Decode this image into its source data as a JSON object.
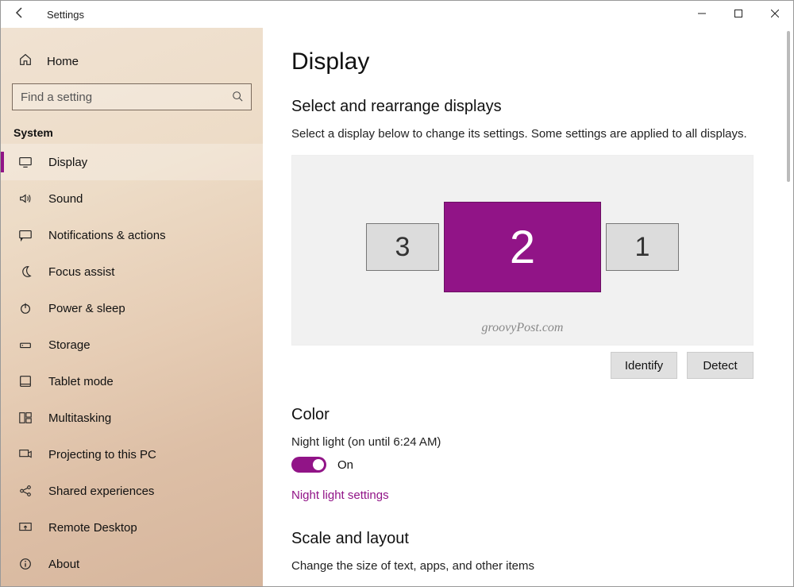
{
  "accent_color": "#911487",
  "titlebar": {
    "title": "Settings"
  },
  "sidebar": {
    "home_label": "Home",
    "search_placeholder": "Find a setting",
    "section_title": "System",
    "items": [
      {
        "id": "display",
        "label": "Display",
        "icon": "monitor",
        "active": true
      },
      {
        "id": "sound",
        "label": "Sound",
        "icon": "sound",
        "active": false
      },
      {
        "id": "notifications",
        "label": "Notifications & actions",
        "icon": "chat",
        "active": false
      },
      {
        "id": "focus",
        "label": "Focus assist",
        "icon": "moon",
        "active": false
      },
      {
        "id": "power",
        "label": "Power & sleep",
        "icon": "power",
        "active": false
      },
      {
        "id": "storage",
        "label": "Storage",
        "icon": "storage",
        "active": false
      },
      {
        "id": "tablet",
        "label": "Tablet mode",
        "icon": "tablet",
        "active": false
      },
      {
        "id": "multitask",
        "label": "Multitasking",
        "icon": "multitask",
        "active": false
      },
      {
        "id": "projecting",
        "label": "Projecting to this PC",
        "icon": "project",
        "active": false
      },
      {
        "id": "shared",
        "label": "Shared experiences",
        "icon": "share",
        "active": false
      },
      {
        "id": "remote",
        "label": "Remote Desktop",
        "icon": "remote",
        "active": false
      },
      {
        "id": "about",
        "label": "About",
        "icon": "info",
        "active": false
      }
    ]
  },
  "main": {
    "page_title": "Display",
    "rearrange": {
      "heading": "Select and rearrange displays",
      "subtext": "Select a display below to change its settings. Some settings are applied to all displays.",
      "displays": [
        {
          "number": "3",
          "selected": false,
          "size": "small"
        },
        {
          "number": "2",
          "selected": true,
          "size": "large"
        },
        {
          "number": "1",
          "selected": false,
          "size": "small"
        }
      ],
      "watermark": "groovyPost.com",
      "identify_label": "Identify",
      "detect_label": "Detect"
    },
    "color": {
      "heading": "Color",
      "night_light_label": "Night light (on until 6:24 AM)",
      "toggle_on": true,
      "toggle_state_label": "On",
      "settings_link": "Night light settings"
    },
    "scale": {
      "heading": "Scale and layout",
      "subtext": "Change the size of text, apps, and other items"
    }
  }
}
